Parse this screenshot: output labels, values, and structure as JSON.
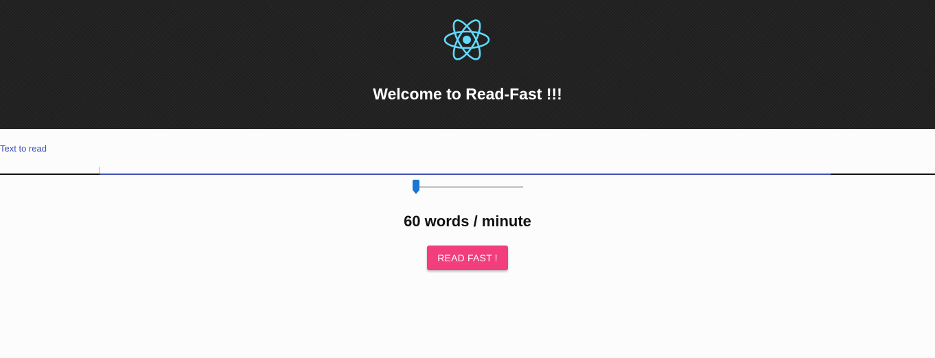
{
  "header": {
    "logo_icon": "react-atom-icon",
    "logo_color": "#61dafb",
    "title": "Welcome to Read-Fast !!!"
  },
  "text_field": {
    "label": "Text to read",
    "value": "",
    "accent_color": "#3f51b5"
  },
  "speed": {
    "slider_value_fraction": 0.0,
    "value": "60",
    "unit": "words / minute",
    "accent_color": "#1976d2"
  },
  "action": {
    "button_label": "READ FAST !",
    "button_color": "#f23e7c"
  }
}
